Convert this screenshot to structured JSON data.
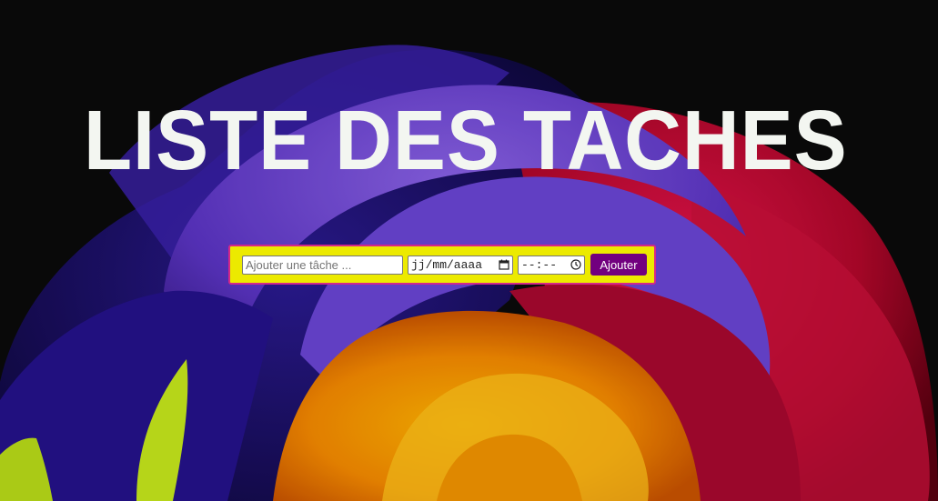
{
  "header": {
    "title": "LISTE DES TACHES"
  },
  "form": {
    "task_placeholder": "Ajouter une tâche ...",
    "date_placeholder": "jj/mm/aaaa",
    "time_placeholder": "--:--",
    "add_label": "Ajouter"
  },
  "colors": {
    "background": "#0a0a0a",
    "title": "#f3f6f1",
    "form_background": "#ecea00",
    "form_border": "#d4278a",
    "button": "#72007f"
  },
  "icons": {
    "date": "calendar-icon",
    "time": "clock-icon"
  }
}
